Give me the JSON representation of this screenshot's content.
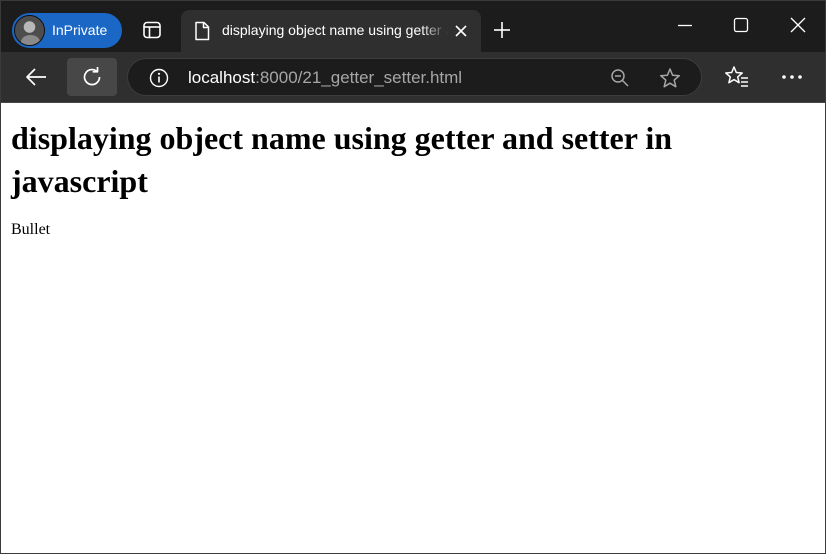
{
  "browser": {
    "profile_label": "InPrivate",
    "tab": {
      "title": "displaying object name using getter and setter in javascript"
    },
    "address": {
      "host": "localhost",
      "path": ":8000/21_getter_setter.html"
    }
  },
  "page": {
    "heading": "displaying object name using getter and setter in javascript",
    "paragraph": "Bullet"
  },
  "colors": {
    "inprivate_accent": "#1a67c5",
    "titlebar_bg": "#1c1c1c",
    "toolbar_bg": "#2f2f2f",
    "page_bg": "#ffffff"
  },
  "icons": [
    "profile-avatar",
    "tab-actions-icon",
    "page-icon",
    "close-icon",
    "plus-icon",
    "minimize-icon",
    "maximize-icon",
    "close-window-icon",
    "back-arrow-icon",
    "reload-icon",
    "info-icon",
    "zoom-out-icon",
    "star-icon",
    "favorites-icon",
    "more-icon"
  ]
}
